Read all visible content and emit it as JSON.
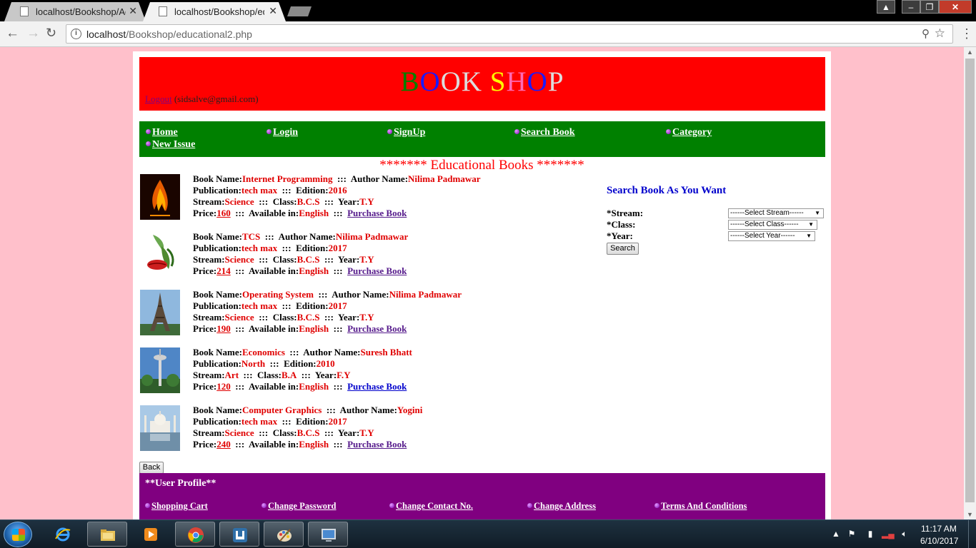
{
  "browser": {
    "tabs": [
      {
        "title": "localhost/Bookshop/Adm",
        "active": false
      },
      {
        "title": "localhost/Bookshop/edu",
        "active": true
      }
    ],
    "url_host": "localhost",
    "url_path": "/Bookshop/educational2.php",
    "close_glyph": "✕"
  },
  "header": {
    "logo_letters": [
      "B",
      "O",
      "O",
      "K",
      " ",
      "S",
      "H",
      "O",
      "P"
    ],
    "logout_label": "Logout",
    "user_email": "(sidsalve@gmail.com)"
  },
  "nav": {
    "items": [
      "Home",
      "Login",
      "SignUp",
      "Search Book",
      "Category",
      "New Issue"
    ]
  },
  "section_title": "******* Educational Books *******",
  "labels": {
    "book_name": "Book Name:",
    "author_name": "Author Name:",
    "publication": "Publication:",
    "edition": "Edition:",
    "stream": "Stream:",
    "class": "Class:",
    "year": "Year:",
    "price": "Price:",
    "available_in": "Available in:",
    "separator": ":::",
    "purchase": "Purchase Book"
  },
  "books": [
    {
      "name": "Internet Programming",
      "author": "Nilima Padmawar",
      "publication": "tech max",
      "edition": "2016",
      "stream": "Science",
      "class": "B.C.S",
      "year": "T.Y",
      "price": "160",
      "language": "English",
      "thumb": "flame"
    },
    {
      "name": "TCS",
      "author": "Nilima Padmawar",
      "publication": "tech max",
      "edition": "2017",
      "stream": "Science",
      "class": "B.C.S",
      "year": "T.Y",
      "price": "214",
      "language": "English",
      "thumb": "lips-flower"
    },
    {
      "name": "Operating System",
      "author": "Nilima Padmawar",
      "publication": "tech max",
      "edition": "2017",
      "stream": "Science",
      "class": "B.C.S",
      "year": "T.Y",
      "price": "190",
      "language": "English",
      "thumb": "eiffel-tower"
    },
    {
      "name": "Economics",
      "author": "Suresh Bhatt",
      "publication": "North",
      "edition": "2010",
      "stream": "Art",
      "class": "B.A",
      "year": "F.Y",
      "price": "120",
      "language": "English",
      "thumb": "tower"
    },
    {
      "name": "Computer Graphics",
      "author": "Yogini",
      "publication": "tech max",
      "edition": "2017",
      "stream": "Science",
      "class": "B.C.S",
      "year": "T.Y",
      "price": "240",
      "language": "English",
      "thumb": "taj-mahal"
    }
  ],
  "search": {
    "title": "Search Book As You Want",
    "stream_label": "*Stream:",
    "class_label": "*Class:",
    "year_label": "*Year:",
    "stream_selected": "------Select Stream------",
    "class_selected": "------Select Class------",
    "year_selected": "------Select Year------",
    "button": "Search"
  },
  "back_button": "Back",
  "profile": {
    "title": "**User Profile**",
    "items": [
      "Shopping Cart",
      "Change Password",
      "Change Contact No.",
      "Change Address",
      "Terms And Conditions"
    ]
  },
  "taskbar": {
    "time": "11:17 AM",
    "date": "6/10/2017"
  },
  "colors": {
    "page_bg": "#ffc0cb",
    "header_bg": "#ff0000",
    "nav_bg": "#008000",
    "profile_bg": "#800080",
    "value_red": "#e00000",
    "search_title": "#0000cc"
  }
}
